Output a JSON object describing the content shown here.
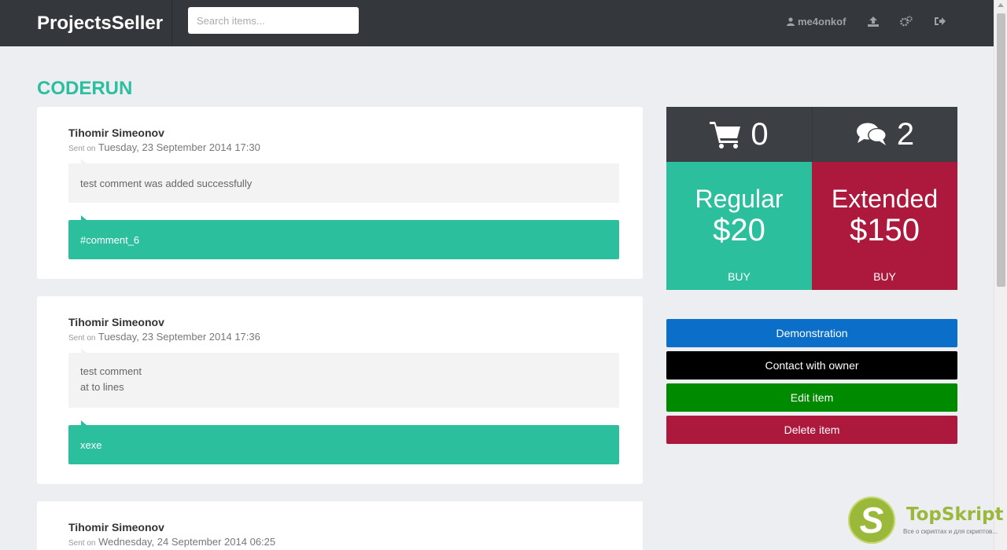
{
  "navbar": {
    "brand": "ProjectsSeller",
    "search_placeholder": "Search items...",
    "username": "me4onkof"
  },
  "page": {
    "title": "CODERUN"
  },
  "comments": [
    {
      "author": "Tihomir Simeonov",
      "sent_label": "Sent on",
      "date": "Tuesday, 23 September 2014 17:30",
      "body": [
        "test comment was added successfully"
      ],
      "reply": "#comment_6"
    },
    {
      "author": "Tihomir Simeonov",
      "sent_label": "Sent on",
      "date": "Tuesday, 23 September 2014 17:36",
      "body": [
        "test comment",
        "at to lines"
      ],
      "reply": "xexe"
    },
    {
      "author": "Tihomir Simeonov",
      "sent_label": "Sent on",
      "date": "Wednesday, 24 September 2014 06:25"
    }
  ],
  "stats": {
    "cart_count": "0",
    "comments_count": "2"
  },
  "pricing": {
    "regular": {
      "plan": "Regular",
      "price": "$20",
      "buy": "BUY",
      "color": "#2bbf9e"
    },
    "extended": {
      "plan": "Extended",
      "price": "$150",
      "buy": "BUY",
      "color": "#ac193d"
    }
  },
  "actions": {
    "demonstration": {
      "label": "Demonstration",
      "color": "#0b6fc9"
    },
    "contact": {
      "label": "Contact with owner",
      "color": "#000000"
    },
    "edit": {
      "label": "Edit item",
      "color": "#008a00"
    },
    "delete": {
      "label": "Delete item",
      "color": "#ac193d"
    }
  },
  "watermark": {
    "letter": "S",
    "name": "TopSkript",
    "tagline": "Все о скриптах и для скриптов..."
  },
  "colors": {
    "accent": "#2bbf9e",
    "navbar": "#34373b",
    "background": "#edeef2"
  }
}
